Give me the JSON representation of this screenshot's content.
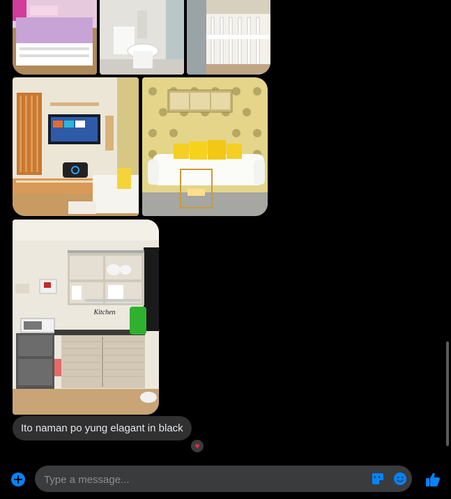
{
  "messages": [
    {
      "type": "image",
      "content": "bedroom photo"
    },
    {
      "type": "image",
      "content": "bathroom photo"
    },
    {
      "type": "image",
      "content": "bunk bed photo"
    },
    {
      "type": "image",
      "content": "living room with tv photo"
    },
    {
      "type": "image",
      "content": "white sofa with yellow pillows photo"
    },
    {
      "type": "image",
      "content": "kitchen photo"
    }
  ],
  "kitchen_sign": "Kitchen",
  "last_message": {
    "text": "Ito naman po yung elagant in black",
    "reaction": "♥"
  },
  "composer": {
    "placeholder": "Type a message..."
  },
  "colors": {
    "accent": "#0084ff",
    "bubble": "#303030",
    "input": "#3a3b3c",
    "reaction": "#f02849"
  },
  "icons": [
    "add-icon",
    "sticker-icon",
    "emoji-icon",
    "thumbs-up-icon",
    "heart-icon"
  ]
}
